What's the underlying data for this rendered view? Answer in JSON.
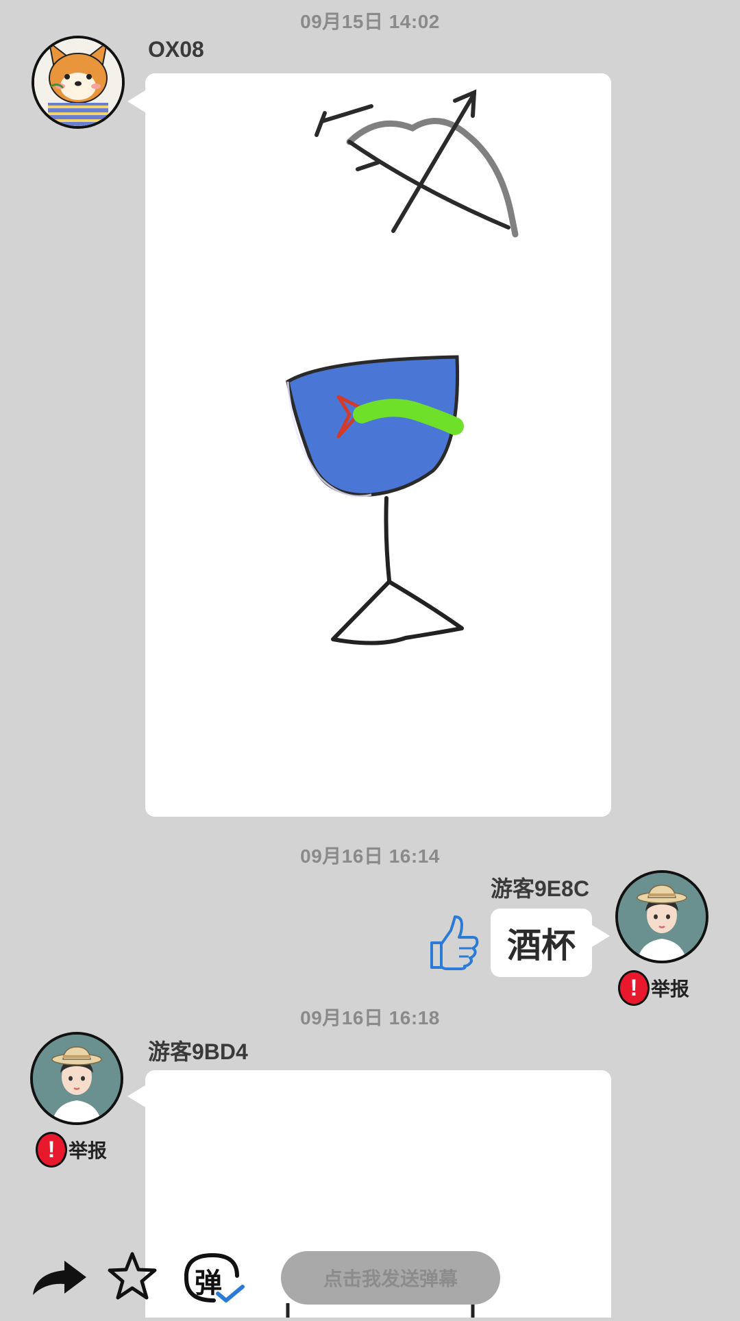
{
  "messages": [
    {
      "timestamp": "09月15日  14:02",
      "username": "OX08",
      "avatar": "shiba-dog-avatar",
      "type": "drawing",
      "drawing": "wine-glass-and-bow-sketch"
    },
    {
      "timestamp": "09月16日  16:14",
      "username": "游客9E8C",
      "avatar": "girl-straw-hat-avatar",
      "type": "text",
      "text": "酒杯",
      "report_label": "举报"
    },
    {
      "timestamp": "09月16日  16:18",
      "username": "游客9BD4",
      "avatar": "girl-straw-hat-avatar",
      "type": "drawing",
      "report_label": "举报"
    }
  ],
  "actions": {
    "like_icon": "thumbs-up-icon",
    "report_icon": "exclamation-icon"
  },
  "bottom_bar": {
    "share_icon": "share-arrow-icon",
    "favorite_icon": "star-icon",
    "danmaku_toggle_icon": "danmaku-toggle-icon",
    "danmaku_toggle_glyph": "弹",
    "danmaku_placeholder": "点击我发送弹幕"
  },
  "colors": {
    "background": "#d3d3d3",
    "bubble": "#ffffff",
    "report_red": "#e8192c",
    "like_blue": "#2a7ad6",
    "glass_blue": "#4a77d6",
    "fish_green": "#6ee02a"
  }
}
